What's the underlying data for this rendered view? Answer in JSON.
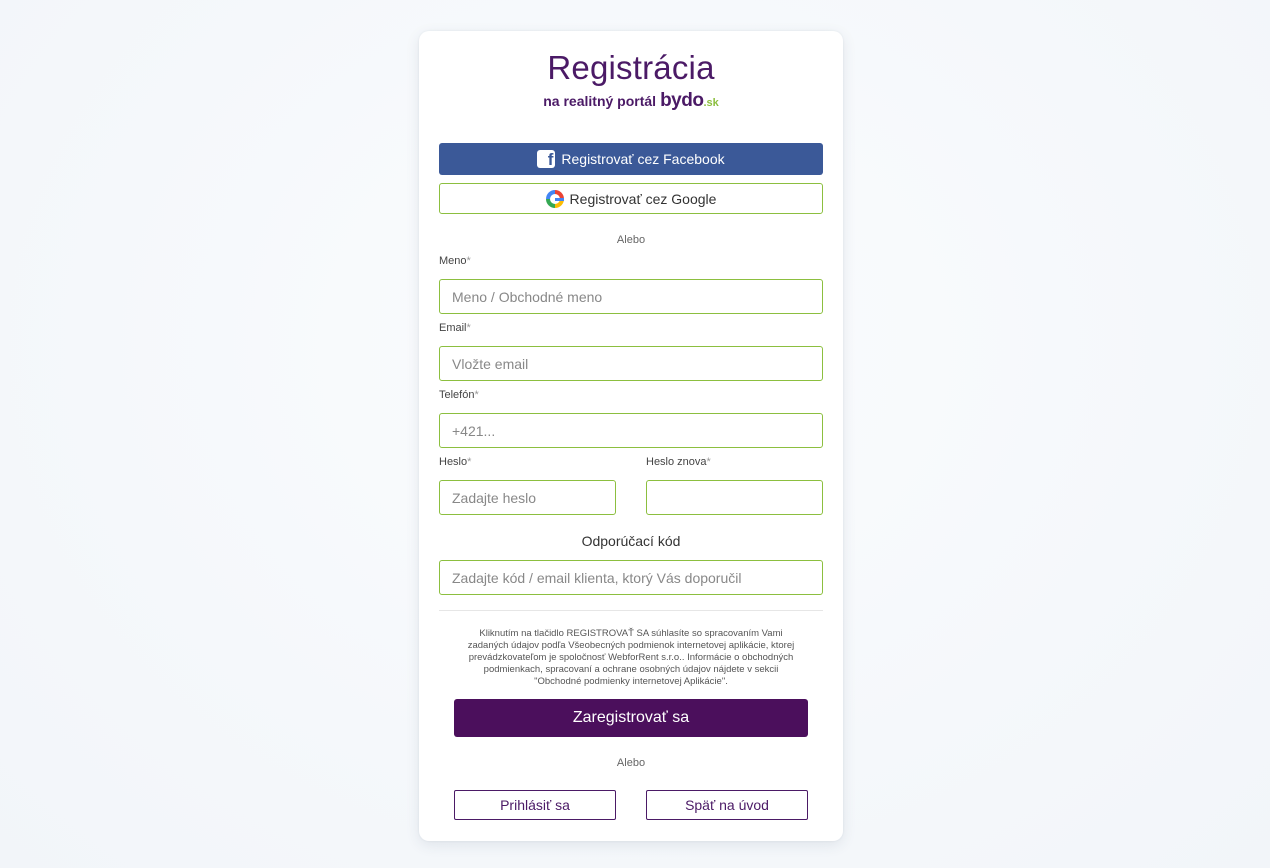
{
  "header": {
    "title": "Registrácia",
    "subtitle": "na realitný portál",
    "brand": "bydo",
    "brand_tld": ".sk"
  },
  "social": {
    "facebook_label": "Registrovať cez Facebook",
    "google_label": "Registrovať cez Google"
  },
  "separator": "Alebo",
  "form": {
    "name_label": "Meno",
    "name_placeholder": "Meno / Obchodné meno",
    "email_label": "Email",
    "email_placeholder": "Vložte email",
    "phone_label": "Telefón",
    "phone_placeholder": "+421...",
    "password_label": "Heslo",
    "password_placeholder": "Zadajte heslo",
    "password_repeat_label": "Heslo znova",
    "password_repeat_placeholder": "",
    "required_mark": "*",
    "referral_label": "Odporúčací kód",
    "referral_placeholder": "Zadajte kód / email klienta, ktorý Vás doporučil"
  },
  "terms_text": "Kliknutím na tlačidlo REGISTROVAŤ SA súhlasíte so spracovaním Vami zadaných údajov podľa Všeobecných podmienok internetovej aplikácie, ktorej prevádzkovateľom je spoločnosť WebforRent s.r.o.. Informácie o obchodných podmienkach, spracovaní a ochrane osobných údajov nájdete v sekcii \"Obchodné podmienky internetovej Aplikácie\".",
  "register_button": "Zaregistrovať sa",
  "separator2": "Alebo",
  "login_button": "Prihlásiť sa",
  "back_button": "Späť na úvod",
  "colors": {
    "brand_purple": "#4b1a66",
    "button_purple": "#4b0f5c",
    "accent_green": "#8cbf3f",
    "facebook_blue": "#3b5998"
  },
  "icons": {
    "facebook": "facebook-icon",
    "google": "google-icon"
  }
}
